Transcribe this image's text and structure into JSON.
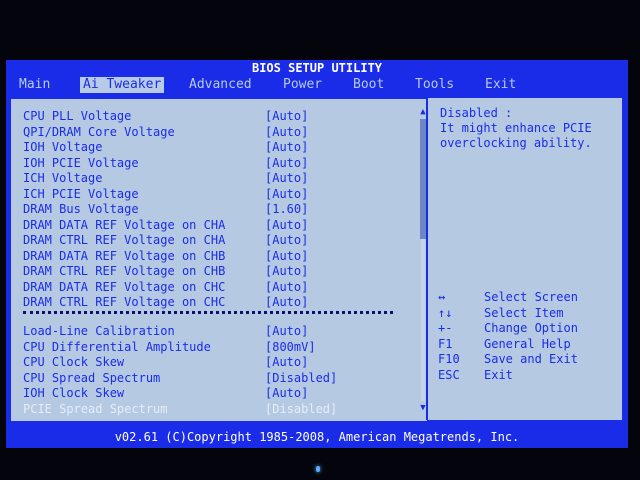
{
  "window": {
    "title": "BIOS SETUP UTILITY"
  },
  "menu": [
    {
      "label": "Main",
      "active": false
    },
    {
      "label": "Ai Tweaker",
      "active": true
    },
    {
      "label": "Advanced",
      "active": false
    },
    {
      "label": "Power",
      "active": false
    },
    {
      "label": "Boot",
      "active": false
    },
    {
      "label": "Tools",
      "active": false
    },
    {
      "label": "Exit",
      "active": false
    }
  ],
  "settings": [
    {
      "label": "CPU PLL Voltage",
      "value": "[Auto]"
    },
    {
      "label": "QPI/DRAM Core Voltage",
      "value": "[Auto]"
    },
    {
      "label": "IOH Voltage",
      "value": "[Auto]"
    },
    {
      "label": "IOH PCIE Voltage",
      "value": "[Auto]"
    },
    {
      "label": "ICH Voltage",
      "value": "[Auto]"
    },
    {
      "label": "ICH PCIE Voltage",
      "value": "[Auto]"
    },
    {
      "label": "DRAM Bus Voltage",
      "value": "[1.60]"
    },
    {
      "label": "DRAM DATA REF Voltage on CHA",
      "value": "[Auto]"
    },
    {
      "label": "DRAM CTRL REF Voltage on CHA",
      "value": "[Auto]"
    },
    {
      "label": "DRAM DATA REF Voltage on CHB",
      "value": "[Auto]"
    },
    {
      "label": "DRAM CTRL REF Voltage on CHB",
      "value": "[Auto]"
    },
    {
      "label": "DRAM DATA REF Voltage on CHC",
      "value": "[Auto]"
    },
    {
      "label": "DRAM CTRL REF Voltage on CHC",
      "value": "[Auto]"
    }
  ],
  "settings2": [
    {
      "label": "Load-Line Calibration",
      "value": "[Auto]"
    },
    {
      "label": "CPU Differential Amplitude",
      "value": "[800mV]"
    },
    {
      "label": "CPU Clock Skew",
      "value": "[Auto]"
    },
    {
      "label": "CPU Spread Spectrum",
      "value": "[Disabled]"
    },
    {
      "label": "IOH Clock Skew",
      "value": "[Auto]"
    },
    {
      "label": "PCIE Spread Spectrum",
      "value": "[Disabled]",
      "highlighted": true
    }
  ],
  "help": {
    "line1": "Disabled :",
    "line2": "It might enhance PCIE",
    "line3": "overclocking ability."
  },
  "keys": [
    {
      "key": "↔",
      "desc": "Select Screen"
    },
    {
      "key": "↑↓",
      "desc": "Select Item"
    },
    {
      "key": "+-",
      "desc": "Change Option"
    },
    {
      "key": "F1",
      "desc": "General Help"
    },
    {
      "key": "F10",
      "desc": "Save and Exit"
    },
    {
      "key": "ESC",
      "desc": "Exit"
    }
  ],
  "footer": "v02.61 (C)Copyright 1985-2008, American Megatrends, Inc.",
  "colors": {
    "background": "#1a2ce8",
    "panel": "#b6c9e3",
    "text": "#1a2ce8",
    "highlight": "#e4edf9"
  }
}
